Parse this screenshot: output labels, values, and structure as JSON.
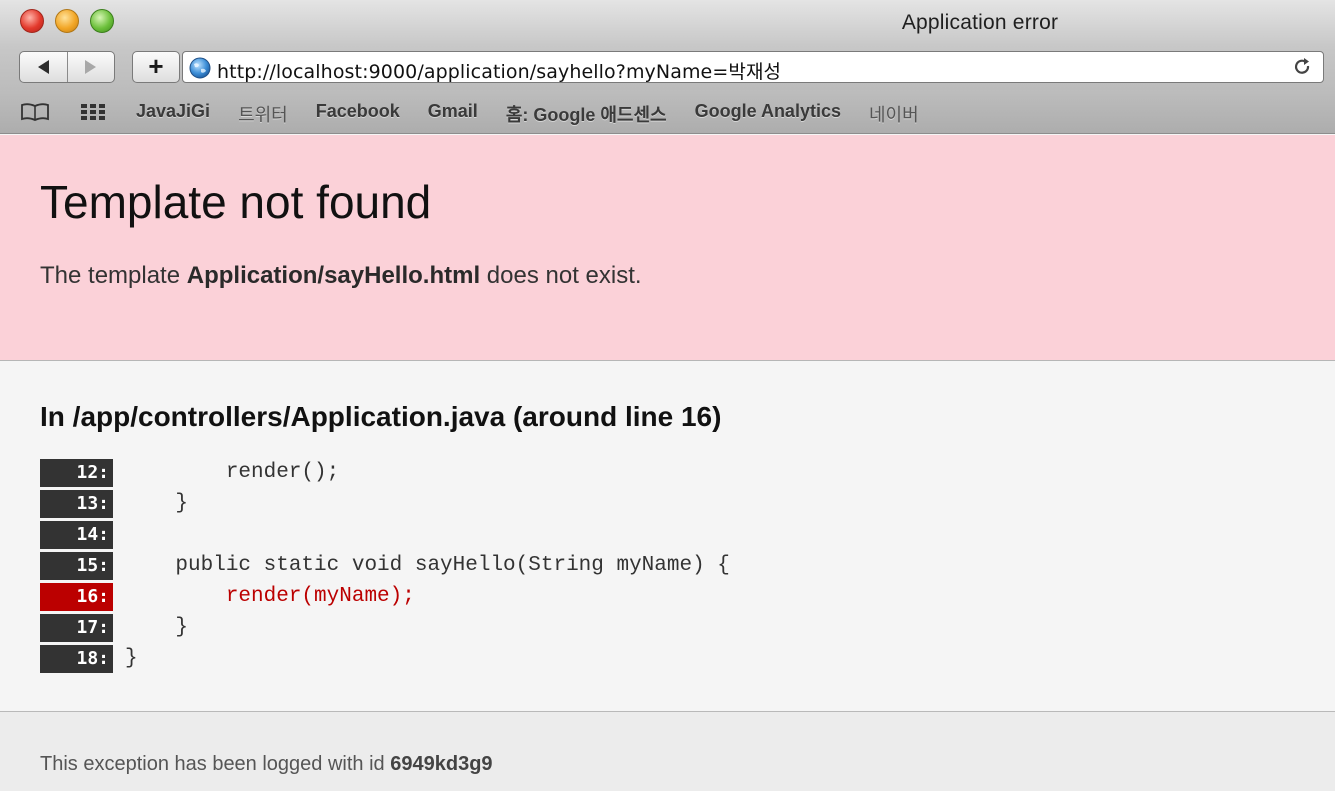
{
  "window": {
    "title": "Application error"
  },
  "toolbar": {
    "back_icon": "back-arrow-icon",
    "forward_icon": "forward-arrow-icon",
    "add_label": "+",
    "url": "http://localhost:9000/application/sayhello?myName=박재성"
  },
  "bookmarks": {
    "items": [
      {
        "label": "JavaJiGi"
      },
      {
        "label": "트위터"
      },
      {
        "label": "Facebook"
      },
      {
        "label": "Gmail"
      },
      {
        "label": "홈: Google 애드센스"
      },
      {
        "label": "Google Analytics"
      },
      {
        "label": "네이버"
      }
    ]
  },
  "error": {
    "title": "Template not found",
    "desc_prefix": "The template ",
    "template_name": "Application/sayHello.html",
    "desc_suffix": " does not exist."
  },
  "source": {
    "title": "In /app/controllers/Application.java (around line 16)",
    "lines": [
      {
        "num": "12:",
        "code": "        render();"
      },
      {
        "num": "13:",
        "code": "    }"
      },
      {
        "num": "14:",
        "code": ""
      },
      {
        "num": "15:",
        "code": "    public static void sayHello(String myName) {"
      },
      {
        "num": "16:",
        "code": "        render(myName);"
      },
      {
        "num": "17:",
        "code": "    }"
      },
      {
        "num": "18:",
        "code": "}"
      }
    ],
    "error_line": "16:"
  },
  "footer": {
    "prefix": "This exception has been logged with id ",
    "id": "6949kd3g9"
  },
  "colors": {
    "error_header_bg": "#fbd1d8",
    "error_line": "#bb0000",
    "line_number_bg": "#333333"
  }
}
